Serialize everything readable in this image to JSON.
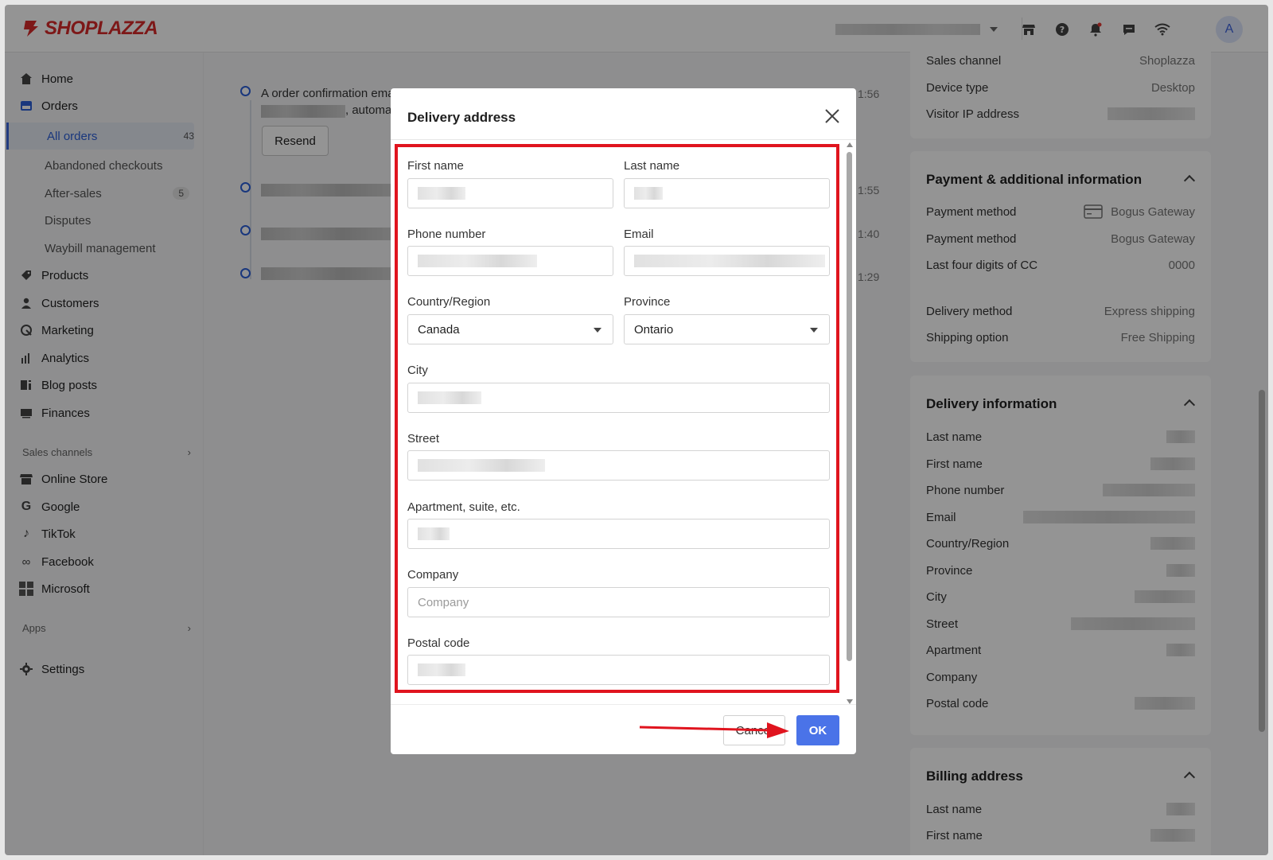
{
  "brand": {
    "name": "SHOPLAZZA",
    "color": "#d82a2a"
  },
  "header": {
    "avatar_initial": "A",
    "icons": [
      "store-icon",
      "help-icon",
      "bell-icon",
      "chat-icon",
      "wifi-icon"
    ]
  },
  "sidebar": {
    "items": [
      {
        "label": "Home",
        "icon": "home-icon"
      },
      {
        "label": "Orders",
        "icon": "orders-icon"
      },
      {
        "label": "Products",
        "icon": "products-icon"
      },
      {
        "label": "Customers",
        "icon": "customers-icon"
      },
      {
        "label": "Marketing",
        "icon": "marketing-icon"
      },
      {
        "label": "Analytics",
        "icon": "analytics-icon"
      },
      {
        "label": "Blog posts",
        "icon": "blog-icon"
      },
      {
        "label": "Finances",
        "icon": "finances-icon"
      }
    ],
    "order_sub": [
      {
        "label": "All orders",
        "badge": "43"
      },
      {
        "label": "Abandoned checkouts",
        "badge": ""
      },
      {
        "label": "After-sales",
        "badge": "5"
      },
      {
        "label": "Disputes",
        "badge": ""
      },
      {
        "label": "Waybill management",
        "badge": ""
      }
    ],
    "sales_channels_label": "Sales channels",
    "channels": [
      {
        "label": "Online Store",
        "icon": "store-icon"
      },
      {
        "label": "Google",
        "icon": "google-icon"
      },
      {
        "label": "TikTok",
        "icon": "tiktok-icon"
      },
      {
        "label": "Facebook",
        "icon": "meta-icon"
      },
      {
        "label": "Microsoft",
        "icon": "microsoft-icon"
      }
    ],
    "apps_label": "Apps",
    "settings_label": "Settings"
  },
  "timeline": {
    "entry1_line1": "A order confirmation ema",
    "entry1_line2": ", automat",
    "resend_label": "Resend",
    "times": [
      "1:56",
      "1:55",
      "1:40",
      "1:29"
    ]
  },
  "cards": {
    "top_rows": [
      {
        "k": "Sales channel",
        "v": "Shoplazza"
      },
      {
        "k": "Device type",
        "v": "Desktop"
      },
      {
        "k": "Visitor IP address",
        "v": ""
      }
    ],
    "payment": {
      "title": "Payment & additional information",
      "rows": [
        {
          "k": "Payment method",
          "v": "Bogus Gateway"
        },
        {
          "k": "Payment method",
          "v": "Bogus Gateway"
        },
        {
          "k": "Last four digits of CC",
          "v": "0000"
        },
        {
          "k": "Delivery method",
          "v": "Express shipping"
        },
        {
          "k": "Shipping option",
          "v": "Free Shipping"
        }
      ]
    },
    "delivery": {
      "title": "Delivery information",
      "rows": [
        "Last name",
        "First name",
        "Phone number",
        "Email",
        "Country/Region",
        "Province",
        "City",
        "Street",
        "Apartment",
        "Company",
        "Postal code"
      ]
    },
    "billing": {
      "title": "Billing address",
      "rows": [
        "Last name",
        "First name"
      ]
    }
  },
  "modal": {
    "title": "Delivery address",
    "fields": {
      "first_name": {
        "label": "First name"
      },
      "last_name": {
        "label": "Last name"
      },
      "phone": {
        "label": "Phone number"
      },
      "email": {
        "label": "Email"
      },
      "country": {
        "label": "Country/Region",
        "value": "Canada"
      },
      "province": {
        "label": "Province",
        "value": "Ontario"
      },
      "city": {
        "label": "City"
      },
      "street": {
        "label": "Street"
      },
      "apartment": {
        "label": "Apartment, suite, etc."
      },
      "company": {
        "label": "Company",
        "placeholder": "Company"
      },
      "postal": {
        "label": "Postal code"
      }
    },
    "cancel_label": "Cancel",
    "ok_label": "OK"
  },
  "colors": {
    "accent": "#4a73e8",
    "highlight": "#e0141e",
    "link": "#2c5fd8"
  }
}
